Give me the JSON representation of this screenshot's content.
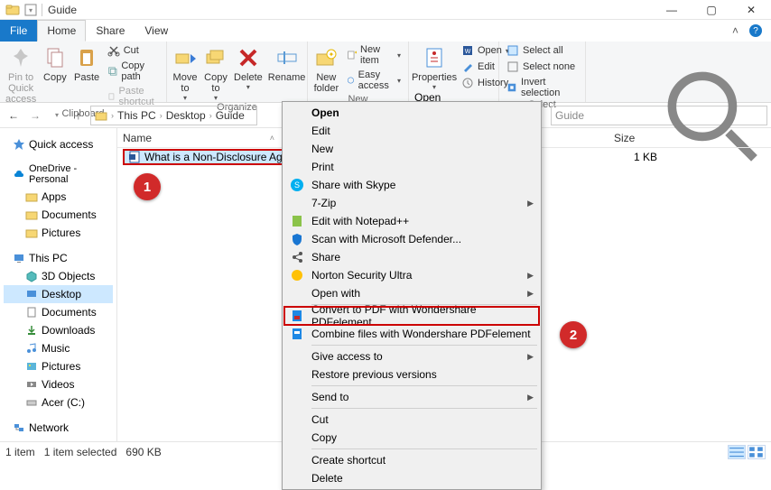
{
  "window_title": "Guide",
  "tabs": {
    "file": "File",
    "home": "Home",
    "share": "Share",
    "view": "View"
  },
  "ribbon": {
    "clipboard": {
      "label": "Clipboard",
      "pin": "Pin to Quick\naccess",
      "copy": "Copy",
      "paste": "Paste",
      "cut": "Cut",
      "copy_path": "Copy path",
      "paste_shortcut": "Paste shortcut"
    },
    "organize": {
      "label": "Organize",
      "move_to": "Move\nto",
      "copy_to": "Copy\nto",
      "delete": "Delete",
      "rename": "Rename"
    },
    "new": {
      "label": "New",
      "new_folder": "New\nfolder",
      "new_item": "New item",
      "easy_access": "Easy access"
    },
    "open": {
      "label": "Open",
      "properties": "Properties",
      "open": "Open",
      "edit": "Edit",
      "history": "History"
    },
    "select": {
      "label": "Select",
      "select_all": "Select all",
      "select_none": "Select none",
      "invert": "Invert selection"
    }
  },
  "breadcrumb": {
    "p1": "This PC",
    "p2": "Desktop",
    "p3": "Guide"
  },
  "search_placeholder": "Guide",
  "nav": {
    "quick_access": "Quick access",
    "onedrive": "OneDrive - Personal",
    "apps": "Apps",
    "documents": "Documents",
    "pictures": "Pictures",
    "this_pc": "This PC",
    "objects3d": "3D Objects",
    "desktop": "Desktop",
    "documents2": "Documents",
    "downloads": "Downloads",
    "music": "Music",
    "pictures2": "Pictures",
    "videos": "Videos",
    "acer": "Acer (C:)",
    "network": "Network"
  },
  "columns": {
    "name": "Name",
    "size": "Size"
  },
  "file": {
    "name": "What is a Non-Disclosure Agreemen",
    "size": "1 KB"
  },
  "context_menu": {
    "open": "Open",
    "edit": "Edit",
    "new": "New",
    "print": "Print",
    "skype": "Share with Skype",
    "sevenzip": "7-Zip",
    "notepadpp": "Edit with Notepad++",
    "defender": "Scan with Microsoft Defender...",
    "share": "Share",
    "norton": "Norton Security Ultra",
    "open_with": "Open with",
    "convert_pdf": "Convert to PDF with Wondershare PDFelement",
    "combine_pdf": "Combine files with Wondershare PDFelement",
    "give_access": "Give access to",
    "restore": "Restore previous versions",
    "send_to": "Send to",
    "cut": "Cut",
    "copy": "Copy",
    "shortcut": "Create shortcut",
    "delete": "Delete"
  },
  "callouts": {
    "one": "1",
    "two": "2"
  },
  "status": {
    "items": "1 item",
    "selected": "1 item selected",
    "size": "690 KB"
  }
}
